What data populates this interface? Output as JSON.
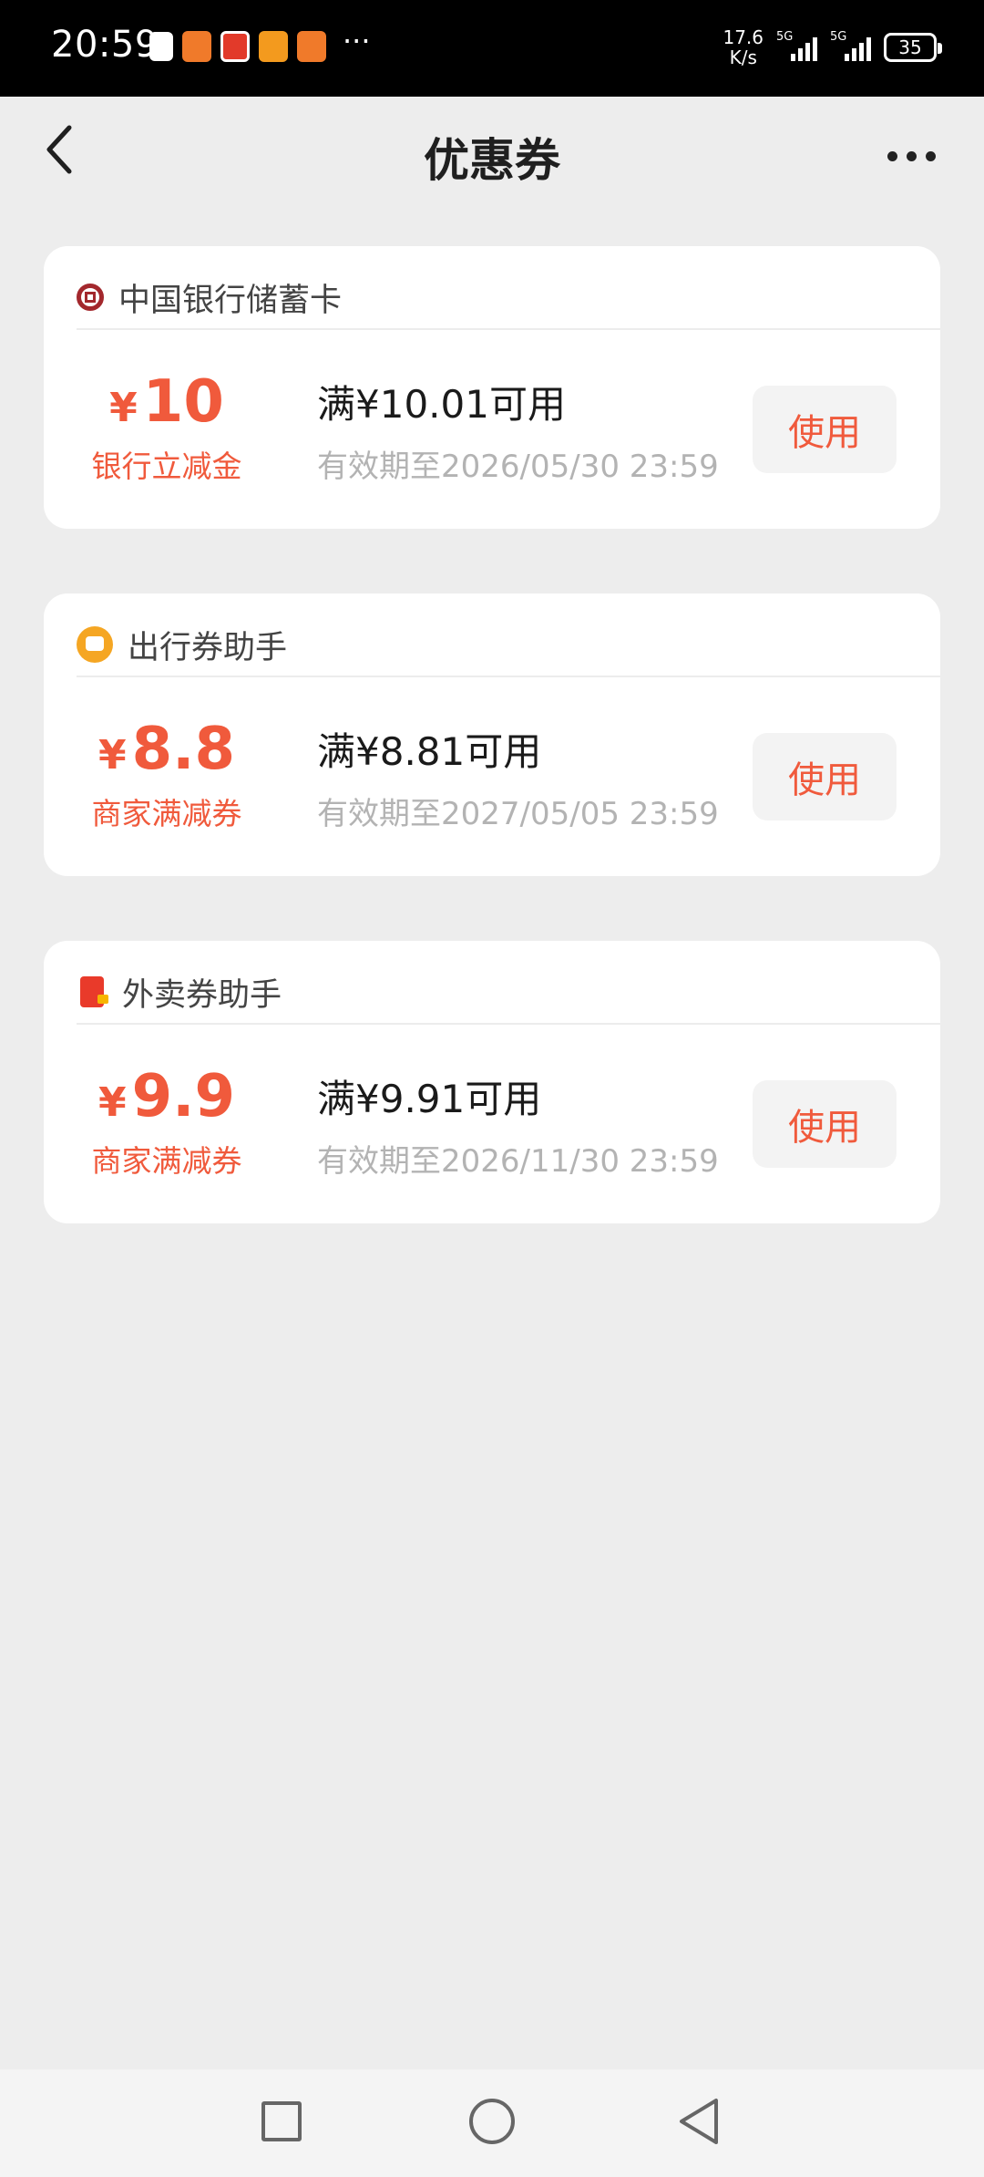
{
  "status_bar": {
    "time": "20:59",
    "more": "···",
    "net_speed": "17.6",
    "net_unit": "K/s",
    "sim1": "5G",
    "sim2": "5G",
    "battery": "35"
  },
  "header": {
    "title": "优惠券"
  },
  "coupons": [
    {
      "shop": "中国银行储蓄卡",
      "icon": "boc-logo-icon",
      "currency": "¥",
      "amount": "10",
      "type": "银行立减金",
      "condition": "满¥10.01可用",
      "expiry": "有效期至2026/05/30 23:59",
      "action": "使用"
    },
    {
      "shop": "出行券助手",
      "icon": "travel-assistant-icon",
      "currency": "¥",
      "amount": "8.8",
      "type": "商家满减券",
      "condition": "满¥8.81可用",
      "expiry": "有效期至2027/05/05 23:59",
      "action": "使用"
    },
    {
      "shop": "外卖券助手",
      "icon": "food-delivery-icon",
      "currency": "¥",
      "amount": "9.9",
      "type": "商家满减券",
      "condition": "满¥9.91可用",
      "expiry": "有效期至2026/11/30 23:59",
      "action": "使用"
    }
  ],
  "colors": {
    "accent": "#f05a3c",
    "background": "#ededed",
    "card": "#ffffff"
  }
}
